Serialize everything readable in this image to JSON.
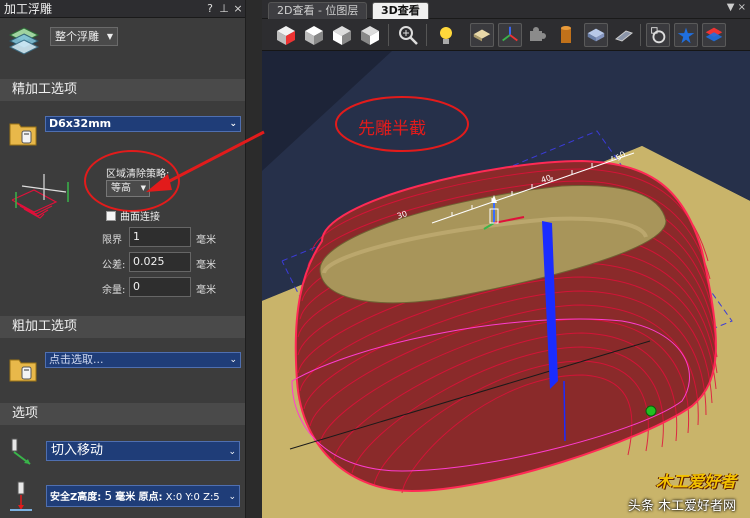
{
  "panel": {
    "title": "加工浮雕",
    "help_btn": "?",
    "pin_btn": "⊥",
    "close_btn": "×",
    "mode": "整个浮雕",
    "finish_section": "精加工选项",
    "finish_tool": "D6x32mm",
    "strategy_label": "区域清除策略:",
    "strategy_value": "等高",
    "surface_connect": "曲面连接",
    "fields": [
      {
        "label": "限界",
        "value": "1",
        "unit": "毫米"
      },
      {
        "label": "公差:",
        "value": "0.025",
        "unit": "毫米"
      },
      {
        "label": "余量:",
        "value": "0",
        "unit": "毫米"
      }
    ],
    "rough_section": "粗加工选项",
    "rough_tool": "点击选取...",
    "options_section": "选项",
    "move_value": "切入移动",
    "safe_z_label": "安全Z高度:",
    "safe_z_value": "5",
    "safe_z_unit": "毫米",
    "origin_label": "原点:",
    "origin_value": "X:0 Y:0 Z:5"
  },
  "viewport": {
    "tabs": [
      {
        "label": "2D查看 - 位图层"
      },
      {
        "label": "3D查看"
      }
    ],
    "tab_controls": "▼ ×",
    "annotation": "先雕半截",
    "ruler_ticks": [
      "30",
      "40",
      "50"
    ],
    "watermark_logo": "木工爱好者",
    "watermark_text": "头条 木工爱好者网"
  },
  "colors": {
    "toolpath_red": "#e0103a",
    "relief_fill": "#a8955a",
    "axis_blue": "#1a2cff",
    "background_wood": "#c9b46a",
    "annotation_red": "#e21b1b"
  }
}
